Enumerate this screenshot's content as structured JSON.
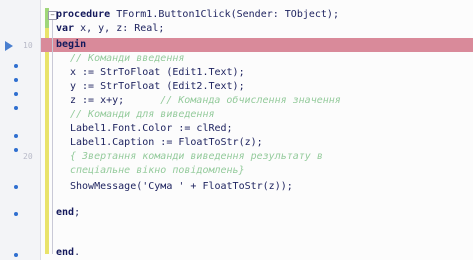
{
  "gutter": {
    "line_numbers": [
      "",
      "",
      "10",
      "",
      "",
      "",
      "",
      "",
      "",
      "",
      "20",
      "",
      "",
      "",
      "",
      "",
      ""
    ]
  },
  "code": {
    "line1": {
      "kw": "procedure",
      "text": " TForm1.Button1Click(Sender: TObject);"
    },
    "line2": {
      "kw": "var",
      "text": " x, y, z: Real;"
    },
    "line3": {
      "kw": "begin",
      "text": ""
    },
    "line4": {
      "comment": "// Команди введення"
    },
    "line5": {
      "text": "x := StrToFloat (Edit1.Text);"
    },
    "line6": {
      "text": "y := StrToFloat (Edit2.Text);"
    },
    "line7": {
      "text": "z := x+y;",
      "comment": "// Команда обчислення значення"
    },
    "line8": {
      "comment": "// Команди для виведення"
    },
    "line9": {
      "text": "Label1.Font.Color := clRed;"
    },
    "line10": {
      "text": "Label1.Caption := FloatToStr(z);"
    },
    "line11": {
      "comment": "{ Звертання команди виведення результату в"
    },
    "line12": {
      "comment": "спеціальне вікно повідомлень}"
    },
    "line13": {
      "text": "ShowMessage('Сума ' + FloatToStr(z));"
    },
    "line14": {
      "kw": "end",
      "text": ";"
    },
    "line15": {
      "kw": "end",
      "text": "."
    }
  }
}
